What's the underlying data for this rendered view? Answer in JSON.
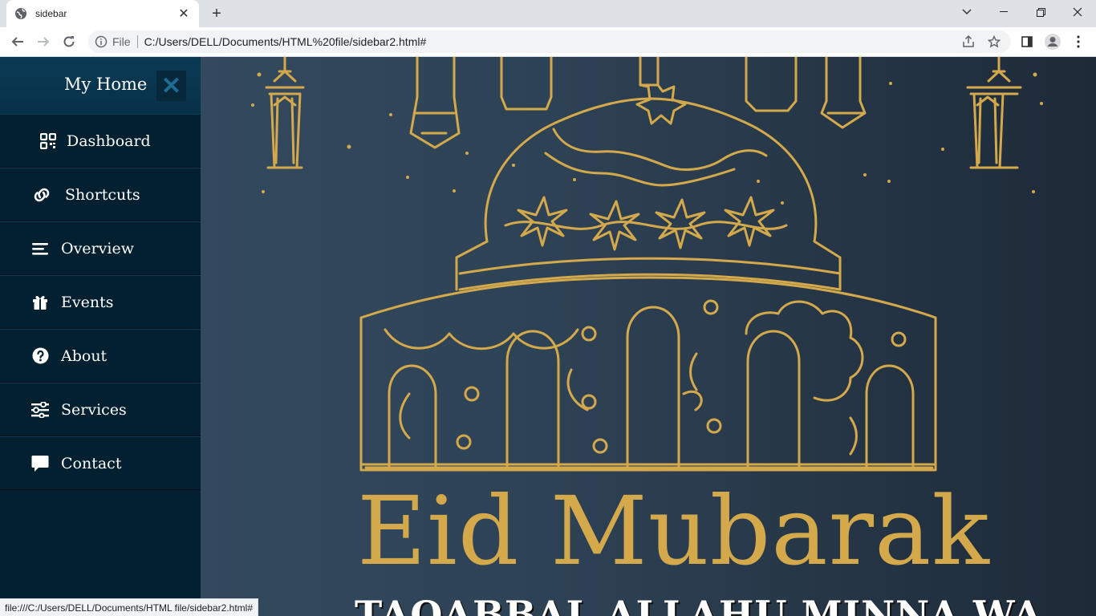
{
  "browser": {
    "tab_title": "sidebar",
    "omnibox_scheme_label": "File",
    "url": "C:/Users/DELL/Documents/HTML%20file/sidebar2.html#",
    "status_url": "file:///C:/Users/DELL/Documents/HTML file/sidebar2.html#"
  },
  "sidebar": {
    "brand": "My Home",
    "close_glyph": "✕",
    "items": [
      {
        "label": "Dashboard",
        "icon": "qrcode-icon"
      },
      {
        "label": "Shortcuts",
        "icon": "link-icon"
      },
      {
        "label": "Overview",
        "icon": "bars-icon"
      },
      {
        "label": "Events",
        "icon": "gift-icon"
      },
      {
        "label": "About",
        "icon": "question-circle-icon"
      },
      {
        "label": "Services",
        "icon": "sliders-icon"
      },
      {
        "label": "Contact",
        "icon": "comment-icon"
      }
    ]
  },
  "hero": {
    "heading": "Eid Mubarak",
    "subheading": "TAQABBAL ALLAHU MINNA WA",
    "colors": {
      "gold": "#d4a94b",
      "background": "#2e4255"
    }
  }
}
